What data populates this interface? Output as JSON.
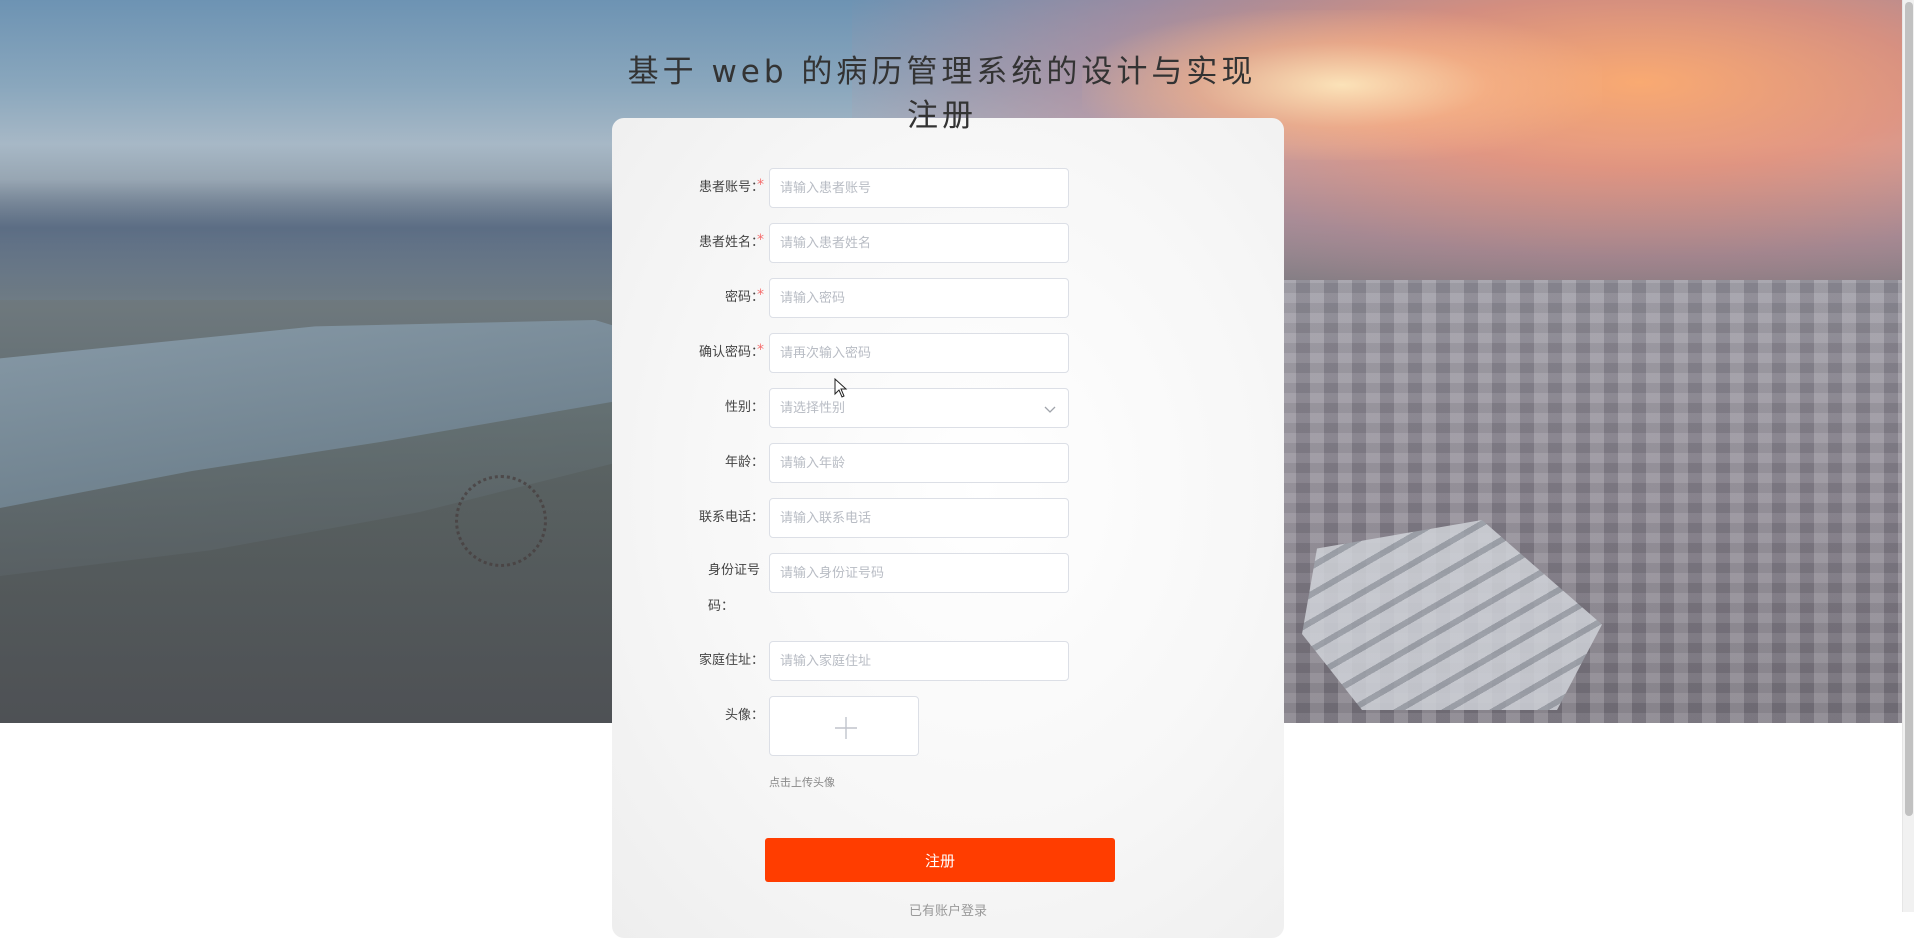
{
  "page": {
    "title": "基于 web 的病历管理系统的设计与实现注册"
  },
  "form": {
    "fields": [
      {
        "label": "患者账号：",
        "placeholder": "请输入患者账号",
        "required": true
      },
      {
        "label": "患者姓名：",
        "placeholder": "请输入患者姓名",
        "required": true
      },
      {
        "label": "密码：",
        "placeholder": "请输入密码",
        "required": true
      },
      {
        "label": "确认密码：",
        "placeholder": "请再次输入密码",
        "required": true
      },
      {
        "label": "性别：",
        "placeholder": "请选择性别",
        "required": false
      },
      {
        "label": "年龄：",
        "placeholder": "请输入年龄",
        "required": false
      },
      {
        "label": "联系电话：",
        "placeholder": "请输入联系电话",
        "required": false
      },
      {
        "label": "身份证号码：",
        "placeholder": "请输入身份证号码",
        "required": false
      },
      {
        "label": "家庭住址：",
        "placeholder": "请输入家庭住址",
        "required": false
      },
      {
        "label": "头像："
      }
    ],
    "required_mark": "*",
    "upload_hint": "点击上传头像",
    "submit_label": "注册",
    "login_link": "已有账户登录"
  },
  "icons": {
    "select_arrow": "chevron-down-icon",
    "upload": "plus-icon",
    "cursor": "mouse-pointer-icon"
  },
  "colors": {
    "accent": "#ff3d00",
    "required": "#f56c6c",
    "border": "#dcdfe6",
    "placeholder": "#b8bcc4"
  }
}
